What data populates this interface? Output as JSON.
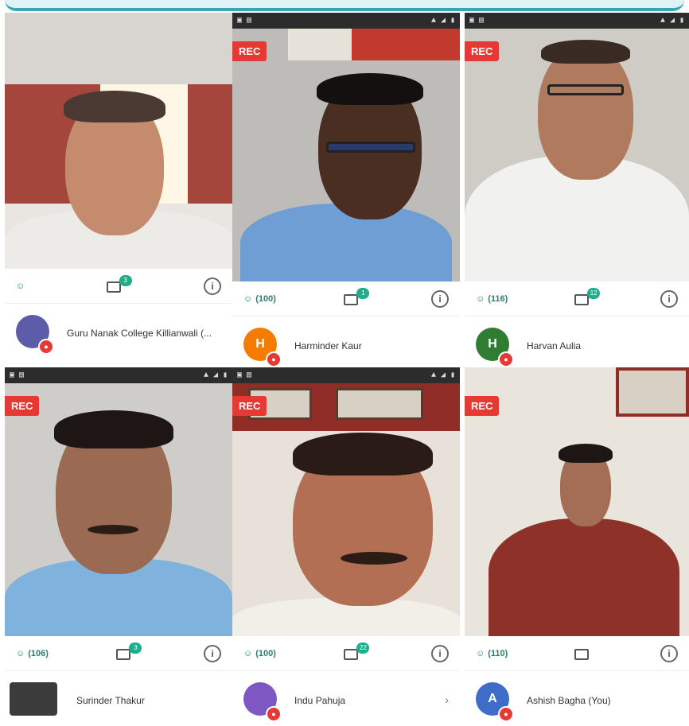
{
  "panels": [
    {
      "toolbar": {
        "participants": "",
        "chat_badge": "3"
      },
      "participant": {
        "name": "Guru Nanak College Killianwali (...",
        "avatar_letter": "",
        "avatar_color": "#5c5ca8"
      }
    },
    {
      "rec": "REC",
      "toolbar": {
        "participants": "(100)",
        "chat_badge": "1"
      },
      "participant": {
        "name": "Harminder Kaur",
        "avatar_letter": "H",
        "avatar_color": "#f57c00"
      }
    },
    {
      "rec": "REC",
      "toolbar": {
        "participants": "(116)",
        "chat_badge": "12"
      },
      "participant": {
        "name": "Harvan Aulia",
        "avatar_letter": "H",
        "avatar_color": "#2e7d32"
      }
    },
    {
      "rec": "REC",
      "toolbar": {
        "participants": "(106)",
        "chat_badge": "3"
      },
      "participant": {
        "name": "Surinder Thakur",
        "avatar_letter": "",
        "avatar_color": "#3b3b3b"
      }
    },
    {
      "rec": "REC",
      "toolbar": {
        "participants": "(100)",
        "chat_badge": "22"
      },
      "participant": {
        "name": "Indu Pahuja",
        "avatar_letter": "",
        "avatar_color": "#7e57c2"
      }
    },
    {
      "rec": "REC",
      "toolbar": {
        "participants": "(110)",
        "chat_badge": ""
      },
      "participant": {
        "name": "Ashish Bagha (You)",
        "avatar_letter": "A",
        "avatar_color": "#3f6cc9"
      }
    }
  ],
  "colors": {
    "rec": "#e53935",
    "accent": "#1fae8c",
    "frame": "#3aa6b4"
  },
  "icons": {
    "chat": "chat-icon",
    "info": "info-icon",
    "participants": "people-icon",
    "mic": "mic-off-icon"
  }
}
